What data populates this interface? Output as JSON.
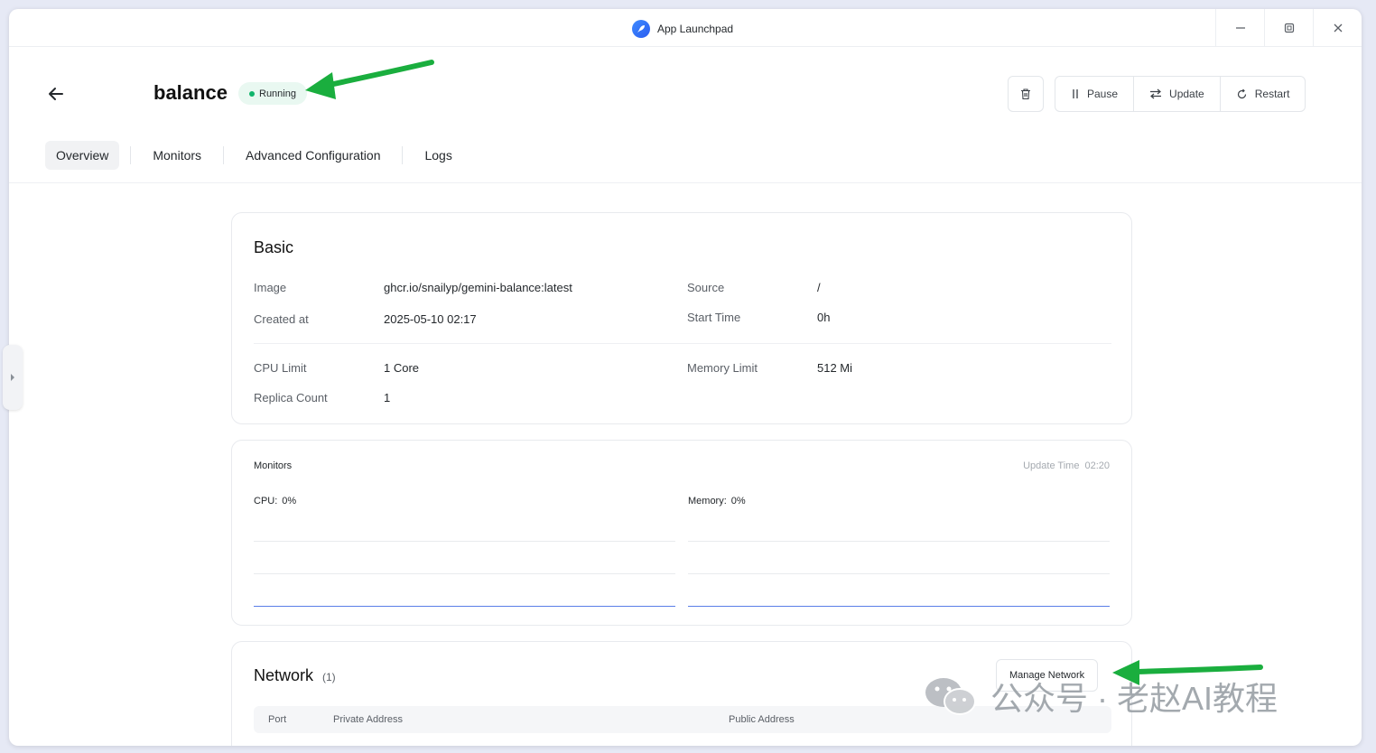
{
  "window": {
    "title": "App Launchpad",
    "icon": "rocket-icon",
    "controls": [
      "minimize-icon",
      "restore-icon",
      "close-icon"
    ]
  },
  "header": {
    "app_name": "balance",
    "status": "Running",
    "status_color": "#0fb46b"
  },
  "actions": {
    "delete_icon": "trash-icon",
    "pause": "Pause",
    "update": "Update",
    "restart": "Restart"
  },
  "tabs": [
    {
      "label": "Overview",
      "active": true
    },
    {
      "label": "Monitors",
      "active": false
    },
    {
      "label": "Advanced Configuration",
      "active": false
    },
    {
      "label": "Logs",
      "active": false
    }
  ],
  "basic": {
    "title": "Basic",
    "image_label": "Image",
    "image_value": "ghcr.io/snailyp/gemini-balance:latest",
    "source_label": "Source",
    "source_value": "/",
    "created_label": "Created at",
    "created_value": "2025-05-10 02:17",
    "start_label": "Start Time",
    "start_value": "0h",
    "cpu_label": "CPU Limit",
    "cpu_value": "1 Core",
    "memory_label": "Memory Limit",
    "memory_value": "512 Mi",
    "replica_label": "Replica Count",
    "replica_value": "1"
  },
  "monitors": {
    "title": "Monitors",
    "update_label": "Update Time",
    "update_value": "02:20",
    "cpu_label": "CPU:",
    "cpu_value": "0%",
    "memory_label": "Memory:",
    "memory_value": "0%",
    "line_color": "#5b7fe8"
  },
  "network": {
    "title": "Network",
    "count": "(1)",
    "manage_button": "Manage Network",
    "columns": [
      "Port",
      "Private Address",
      "Public Address"
    ]
  },
  "watermark": {
    "text": "公众号 · 老赵AI教程"
  },
  "annotations": {
    "arrow_color": "#1aae3e"
  }
}
